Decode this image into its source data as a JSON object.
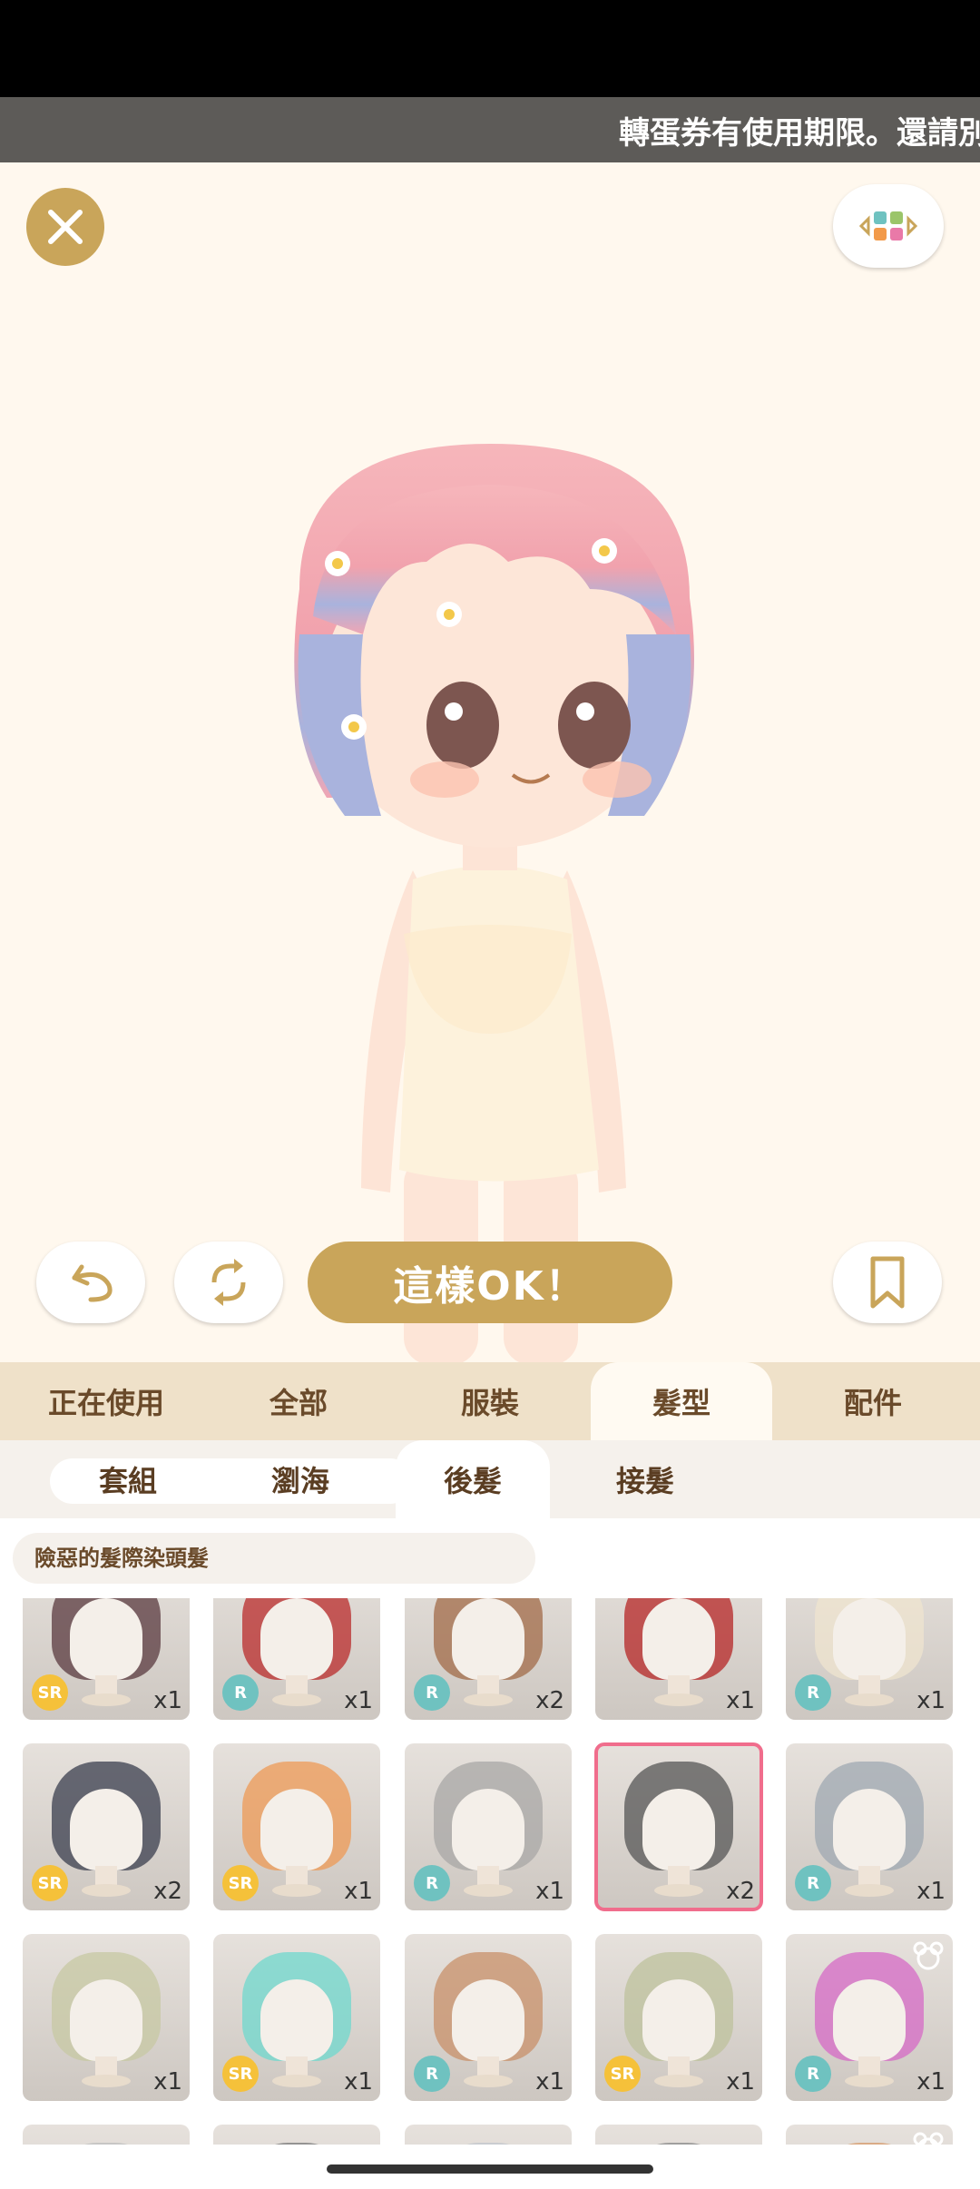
{
  "marquee": {
    "text": "轉蛋券有使用期限。還請別"
  },
  "toolbar": {
    "ok_label": "這樣OK！"
  },
  "tabs": [
    {
      "label": "正在使用"
    },
    {
      "label": "全部"
    },
    {
      "label": "服裝"
    },
    {
      "label": "髮型",
      "active": true
    },
    {
      "label": "配件"
    }
  ],
  "subtabs": [
    {
      "label": "套組"
    },
    {
      "label": "瀏海"
    },
    {
      "label": "後髮",
      "active": true
    },
    {
      "label": "接髮"
    }
  ],
  "item_label": "險惡的髮際染頭髮",
  "items": [
    {
      "rarity": "SR",
      "count": "x1",
      "hair": "#5a3a3f"
    },
    {
      "rarity": "R",
      "count": "x1",
      "hair": "#b92b2b"
    },
    {
      "rarity": "R",
      "count": "x2",
      "hair": "#a26b48"
    },
    {
      "rarity": "",
      "count": "x1",
      "hair": "#b52525"
    },
    {
      "rarity": "R",
      "count": "x1",
      "hair": "#efe4cf"
    },
    {
      "rarity": "SR",
      "count": "x2",
      "hair": "#3a3e4e"
    },
    {
      "rarity": "SR",
      "count": "x1",
      "hair": "#ee9a55"
    },
    {
      "rarity": "R",
      "count": "x1",
      "hair": "#a8a7a5"
    },
    {
      "rarity": "",
      "count": "x2",
      "hair": "#555555",
      "selected": true
    },
    {
      "rarity": "R",
      "count": "x1",
      "hair": "#9fa8b2"
    },
    {
      "rarity": "",
      "count": "x1",
      "hair": "#c7c8a3"
    },
    {
      "rarity": "SR",
      "count": "x1",
      "hair": "#6fd8cd"
    },
    {
      "rarity": "R",
      "count": "x1",
      "hair": "#c8906a"
    },
    {
      "rarity": "SR",
      "count": "x1",
      "hair": "#bdc29c"
    },
    {
      "rarity": "R",
      "count": "x1",
      "hair": "#d569c6",
      "paw": true
    },
    {
      "rarity": "",
      "count": "",
      "hair": "#bdbdbd"
    },
    {
      "rarity": "",
      "count": "",
      "hair": "#7a7a7a"
    },
    {
      "rarity": "",
      "count": "",
      "hair": "#c2c6cc"
    },
    {
      "rarity": "",
      "count": "",
      "hair": "#8a8a8a"
    },
    {
      "rarity": "",
      "count": "",
      "hair": "#d79a6a",
      "paw": true
    }
  ],
  "icons": {
    "close": "close-icon",
    "grid": "grid-icon",
    "undo": "undo-icon",
    "refresh": "refresh-icon",
    "bookmark": "bookmark-icon"
  },
  "colors": {
    "accent": "#c9a55a",
    "selected": "#f06d8c"
  }
}
